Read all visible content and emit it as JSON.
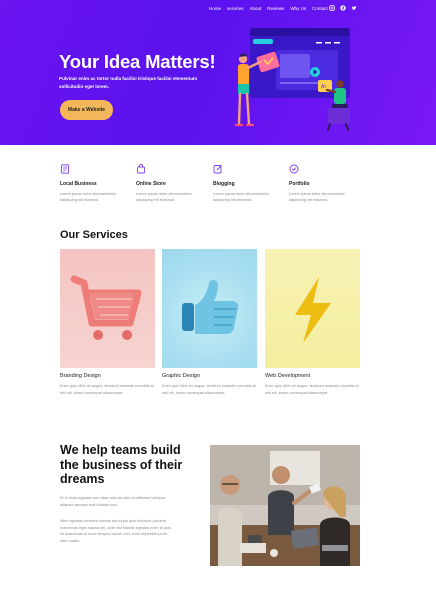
{
  "nav": {
    "items": [
      "Home",
      "services",
      "About",
      "Reviews",
      "Why Us",
      "Contact"
    ]
  },
  "social": [
    "instagram-icon",
    "facebook-icon",
    "twitter-icon"
  ],
  "hero": {
    "title": "Your Idea Matters!",
    "subtitle": "Pulvinar enim ac tortor nulla facilisi tristique facilisi elementum sollicitudin eget lorem.",
    "button_label": "Make a Website",
    "colors": {
      "gradient_start": "#6a14f0",
      "gradient_end": "#7a19f5",
      "button": "#f4b65a"
    }
  },
  "features": [
    {
      "icon": "document-icon",
      "title": "Local Business",
      "text": "Lorem ipsum dolor sitconsectetur adipiscing elit eiusmod."
    },
    {
      "icon": "shop-bag-icon",
      "title": "Online Store",
      "text": "Lorem ipsum dolor sitconsectetur adipiscing elit eiusmod."
    },
    {
      "icon": "edit-icon",
      "title": "Blogging",
      "text": "Lorem ipsum dolor sitconsectetur adipiscing elit eiusmod."
    },
    {
      "icon": "check-badge-icon",
      "title": "Portfolio",
      "text": "Lorem ipsum dolor sitconsectetur adipiscing elit eiusmod."
    }
  ],
  "services": {
    "title": "Our Services",
    "cards": [
      {
        "title": "Branding Design",
        "text": "Enim quis nibh vel augue, tincidunt molestie convallis at nisl elit, lorem consequat ullamcorper."
      },
      {
        "title": "Graphic Design",
        "text": "Enim quis nibh vel augue, tincidunt molestie convallis at nisl elit, lorem consequat ullamcorper."
      },
      {
        "title": "Web Development",
        "text": "Enim quis nibh vel augue, tincidunt molestie convallis at nisl elit, lorem consequat ullamcorper."
      }
    ]
  },
  "team": {
    "title": "We help teams build the business of their dreams",
    "paragraph_1": "Et in risus egestas nec vitae odio ac nibh vestibulum volutpat aliquam aenean erat lobortis non.",
    "paragraph_2": "Nibh egestas dictumst cursus est turpis quis tincidunt pulvinar maecenas eget massa vel, ante nisl blandit egestas enim id quis sit maecenas id nunc tempus auctor orci, enim imperdiet proin nibh mattis."
  }
}
